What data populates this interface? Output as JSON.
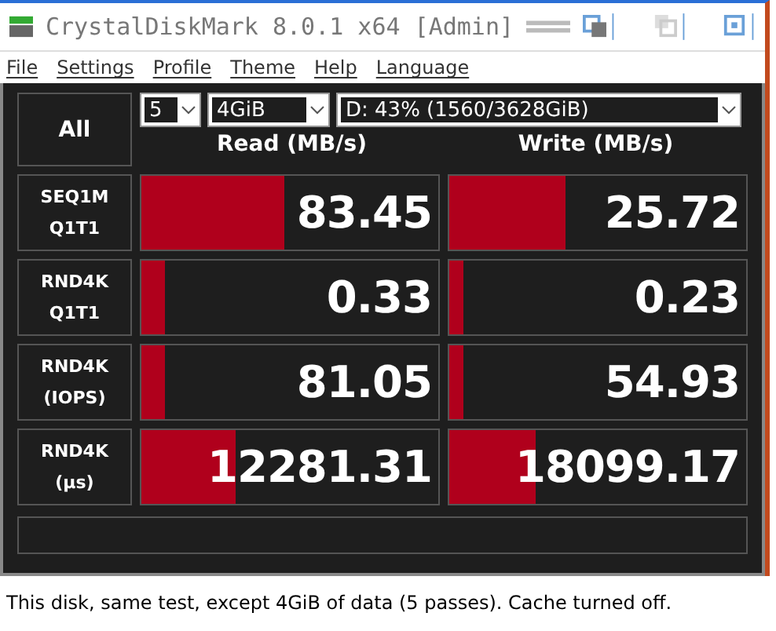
{
  "window": {
    "title": "CrystalDiskMark 8.0.1 x64 [Admin]"
  },
  "menu": [
    "File",
    "Settings",
    "Profile",
    "Theme",
    "Help",
    "Language"
  ],
  "all_button": "All",
  "controls": {
    "count": "5",
    "size": "4GiB",
    "drive": "D: 43% (1560/3628GiB)"
  },
  "columns": [
    "Read (MB/s)",
    "Write (MB/s)"
  ],
  "rows": [
    {
      "label": [
        "SEQ1M",
        "Q1T1"
      ],
      "read": {
        "value": "83.45",
        "level": 0.48
      },
      "write": {
        "value": "25.72",
        "level": 0.39
      }
    },
    {
      "label": [
        "RND4K",
        "Q1T1"
      ],
      "read": {
        "value": "0.33",
        "level": 0.08
      },
      "write": {
        "value": "0.23",
        "level": 0.05
      }
    },
    {
      "label": [
        "RND4K",
        "(IOPS)"
      ],
      "read": {
        "value": "81.05",
        "level": 0.08
      },
      "write": {
        "value": "54.93",
        "level": 0.05
      }
    },
    {
      "label": [
        "RND4K",
        "(µs)"
      ],
      "read": {
        "value": "12281.31",
        "level": 0.32
      },
      "write": {
        "value": "18099.17",
        "level": 0.29
      }
    }
  ],
  "caption": "This disk, same test, except 4GiB of data (5 passes). Cache turned off."
}
